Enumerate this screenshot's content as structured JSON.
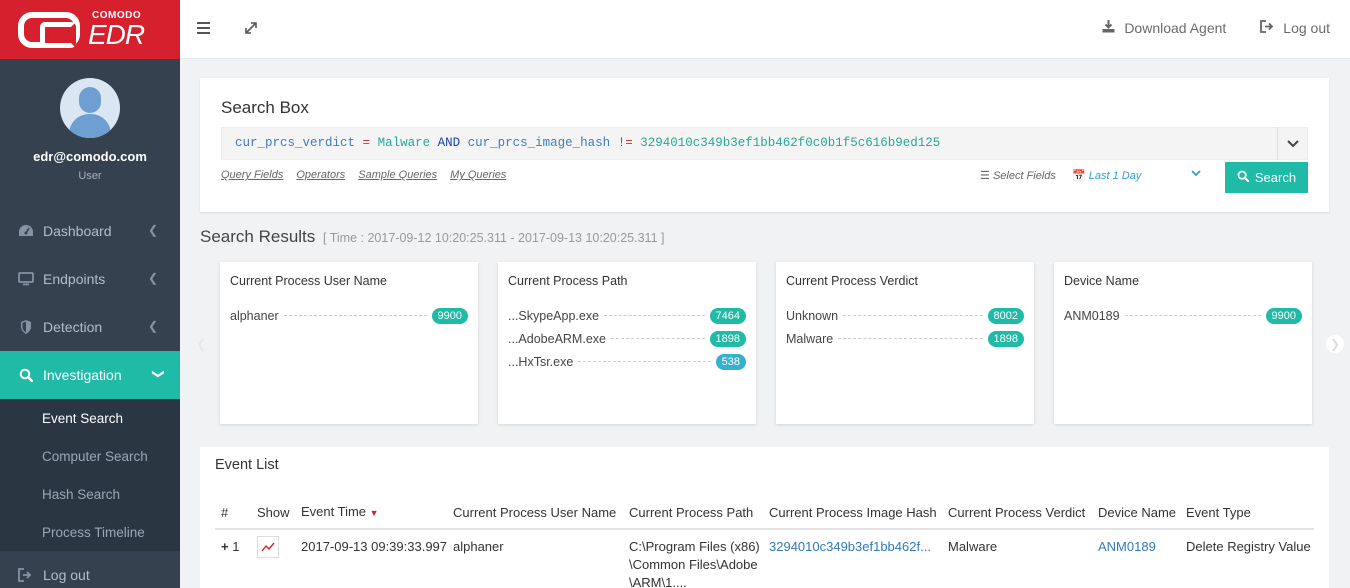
{
  "brand": {
    "small": "COMODO",
    "big": "EDR"
  },
  "user": {
    "email": "edr@comodo.com",
    "role": "User"
  },
  "sidebar": {
    "items": [
      {
        "label": "Dashboard",
        "icon": "dashboard-icon"
      },
      {
        "label": "Endpoints",
        "icon": "monitor-icon"
      },
      {
        "label": "Detection",
        "icon": "shield-icon"
      },
      {
        "label": "Investigation",
        "icon": "search-icon"
      }
    ],
    "sub_items": [
      "Event Search",
      "Computer Search",
      "Hash Search",
      "Process Timeline"
    ],
    "logout_label": "Log out"
  },
  "topbar": {
    "download_label": "Download Agent",
    "logout_label": "Log out"
  },
  "search": {
    "title": "Search Box",
    "query": {
      "field1": "cur_prcs_verdict",
      "op1": "=",
      "val1": "Malware",
      "kw": "AND",
      "field2": "cur_prcs_image_hash",
      "op2": "!=",
      "val2": "3294010c349b3ef1bb462f0c0b1f5c616b9ed125"
    },
    "links": [
      "Query Fields",
      "Operators",
      "Sample Queries",
      "My Queries"
    ],
    "select_fields_label": "Select Fields",
    "time_range": "Last 1 Day",
    "button_label": "Search"
  },
  "results": {
    "title": "Search Results",
    "time_label": "[ Time : 2017-09-12 10:20:25.311 - 2017-09-13 10:20:25.311 ]",
    "cards": [
      {
        "title": "Current Process User Name",
        "rows": [
          {
            "label": "alphaner",
            "count": "9900"
          }
        ]
      },
      {
        "title": "Current Process Path",
        "rows": [
          {
            "label": "...SkypeApp.exe",
            "count": "7464"
          },
          {
            "label": "...AdobeARM.exe",
            "count": "1898"
          },
          {
            "label": "...HxTsr.exe",
            "count": "538"
          }
        ]
      },
      {
        "title": "Current Process Verdict",
        "rows": [
          {
            "label": "Unknown",
            "count": "8002"
          },
          {
            "label": "Malware",
            "count": "1898"
          }
        ]
      },
      {
        "title": "Device Name",
        "rows": [
          {
            "label": "ANM0189",
            "count": "9900"
          }
        ]
      }
    ]
  },
  "events": {
    "title": "Event List",
    "headers": [
      "#",
      "Show",
      "Event Time",
      "Current Process User Name",
      "Current Process Path",
      "Current Process Image Hash",
      "Current Process Verdict",
      "Device Name",
      "Event Type"
    ],
    "rows": [
      {
        "num": "1",
        "time": "2017-09-13 09:39:33.997",
        "user": "alphaner",
        "path": "C:\\Program Files (x86)\\Common Files\\Adobe\\ARM\\1....",
        "hash": "3294010c349b3ef1bb462f...",
        "verdict": "Malware",
        "device": "ANM0189",
        "type": "Delete Registry Value"
      }
    ]
  },
  "colors": {
    "brand": "#d6202d",
    "accent": "#1fbba6",
    "sidebar": "#364150"
  }
}
